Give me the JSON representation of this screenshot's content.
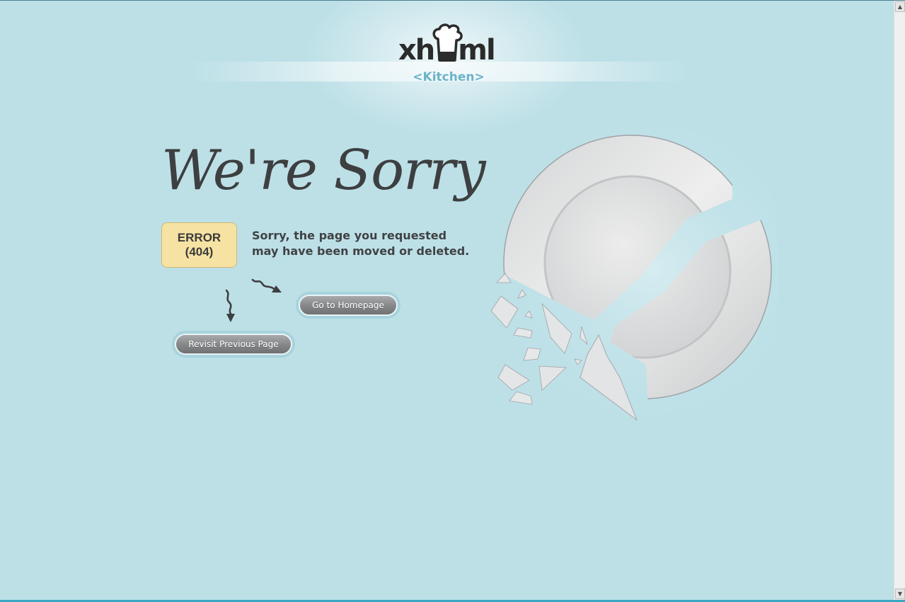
{
  "brand": {
    "logo_left": "xh",
    "logo_right": "ml",
    "logo_sub": "<Kitchen>"
  },
  "heading": "We're Sorry",
  "error": {
    "line1": "ERROR",
    "line2": "(404)"
  },
  "message": {
    "line1": "Sorry, the page you requested",
    "line2": "may have been moved or deleted."
  },
  "buttons": {
    "home": "Go to Homepage",
    "previous": "Revisit Previous Page"
  },
  "icons": {
    "logo_hat": "chef-hat-icon",
    "arrow_home": "squiggle-arrow-right-icon",
    "arrow_previous": "squiggle-arrow-down-icon",
    "illustration": "broken-plate-illustration",
    "scroll_up": "scroll-up-arrow-icon",
    "scroll_down": "scroll-down-arrow-icon"
  },
  "colors": {
    "background": "#bde0e7",
    "error_box": "#f6e3a3",
    "logo_accent": "#6ab3c9",
    "text_dark": "#3d3f40"
  }
}
